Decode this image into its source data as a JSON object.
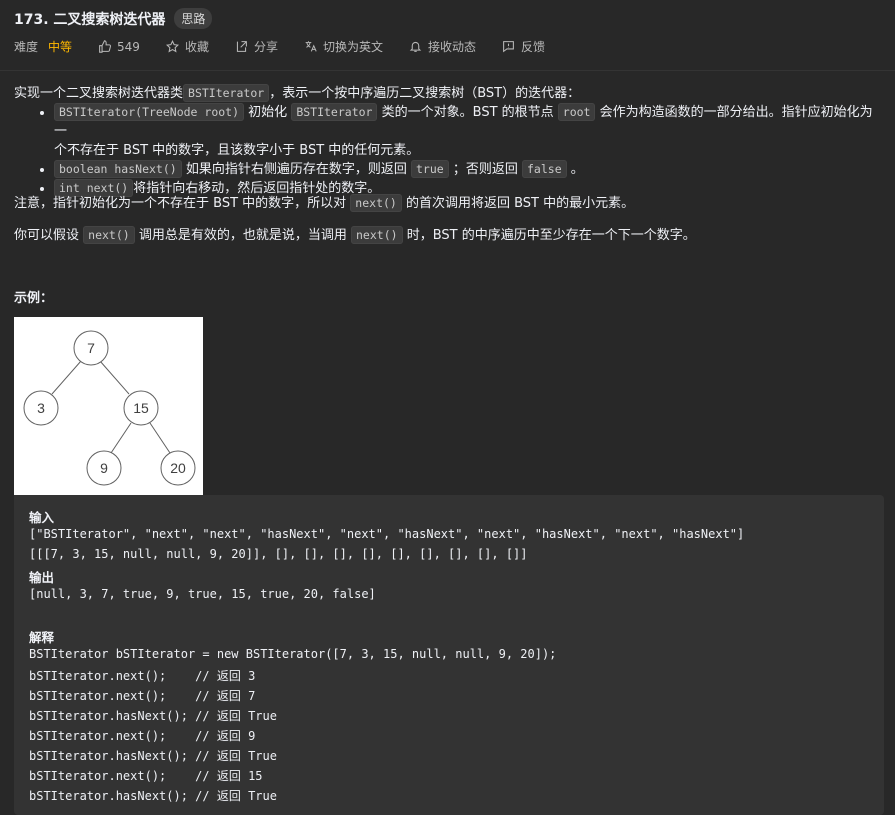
{
  "header": {
    "title": "173. 二叉搜索树迭代器",
    "tag": "思路"
  },
  "meta": {
    "difficulty_label": "难度",
    "difficulty_value": "中等",
    "likes": "549",
    "favorite": "收藏",
    "share": "分享",
    "switch_lang": "切换为英文",
    "subscribe": "接收动态",
    "feedback": "反馈"
  },
  "description": {
    "intro_a": "实现一个二叉搜索树迭代器类",
    "intro_code": "BSTIterator",
    "intro_b": "，表示一个按中序遍历二叉搜索树（BST）的迭代器：",
    "li1_code1": "BSTIterator(TreeNode root)",
    "li1_a": "初始化",
    "li1_code2": "BSTIterator",
    "li1_b": "类的一个对象。BST 的根节点",
    "li1_code3": "root",
    "li1_c": "会作为构造函数的一部分给出。指针应初始化为一",
    "li1_d": "个不存在于 BST 中的数字，且该数字小于 BST 中的任何元素。",
    "li2_code1": "boolean hasNext()",
    "li2_a": "如果向指针右侧遍历存在数字，则返回",
    "li2_code2": "true",
    "li2_b": "；否则返回",
    "li2_code3": "false",
    "li2_c": "。",
    "li3_code1": "int next()",
    "li3_a": "将指针向右移动，然后返回指针处的数字。",
    "note_a": "注意，指针初始化为一个不存在于 BST 中的数字，所以对",
    "note_code": "next()",
    "note_b": "的首次调用将返回 BST 中的最小元素。",
    "valid_a": "你可以假设",
    "valid_code1": "next()",
    "valid_b": "调用总是有效的，也就是说，当调用",
    "valid_code2": "next()",
    "valid_c": "时，BST 的中序遍历中至少存在一个下一个数字。"
  },
  "example": {
    "heading": "示例：",
    "tree_nodes": [
      "7",
      "3",
      "15",
      "9",
      "20"
    ],
    "input_label": "输入",
    "input_line1": "[\"BSTIterator\", \"next\", \"next\", \"hasNext\", \"next\", \"hasNext\", \"next\", \"hasNext\", \"next\", \"hasNext\"]",
    "input_line2": "[[[7, 3, 15, null, null, 9, 20]], [], [], [], [], [], [], [], [], []]",
    "output_label": "输出",
    "output_line": "[null, 3, 7, true, 9, true, 15, true, 20, false]",
    "explain_label": "解释",
    "explain_lines": [
      "BSTIterator bSTIterator = new BSTIterator([7, 3, 15, null, null, 9, 20]);",
      "bSTIterator.next();    // 返回 3",
      "bSTIterator.next();    // 返回 7",
      "bSTIterator.hasNext(); // 返回 True",
      "bSTIterator.next();    // 返回 9",
      "bSTIterator.hasNext(); // 返回 True",
      "bSTIterator.next();    // 返回 15",
      "bSTIterator.hasNext(); // 返回 True"
    ]
  },
  "colors": {
    "background": "#282828",
    "difficulty_medium": "#ffb800",
    "code_block": "#333333"
  }
}
